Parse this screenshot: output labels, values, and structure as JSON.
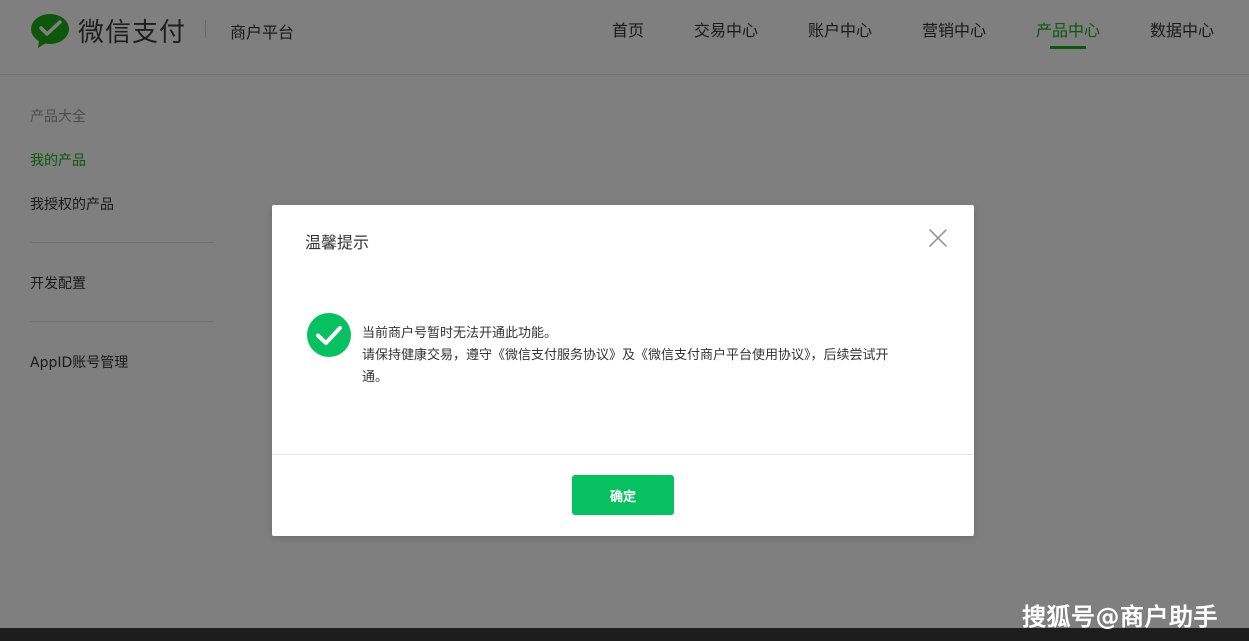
{
  "header": {
    "logo_text": "微信支付",
    "platform_name": "商户平台",
    "nav": [
      {
        "label": "首页"
      },
      {
        "label": "交易中心"
      },
      {
        "label": "账户中心"
      },
      {
        "label": "营销中心"
      },
      {
        "label": "产品中心",
        "active": true
      },
      {
        "label": "数据中心"
      }
    ]
  },
  "sidebar": {
    "items": [
      {
        "label": "产品大全"
      },
      {
        "label": "我的产品",
        "active": true
      },
      {
        "label": "我授权的产品"
      },
      {
        "label": "开发配置"
      },
      {
        "label": "AppID账号管理"
      }
    ]
  },
  "dialog": {
    "title": "温馨提示",
    "message_line1": "当前商户号暂时无法开通此功能。",
    "message_line2": "请保持健康交易，遵守《微信支付服务协议》及《微信支付商户平台使用协议》，后续尝试开",
    "message_line3": "通。",
    "confirm_label": "确定"
  },
  "watermark": "搜狐号@商户助手",
  "colors": {
    "brand_green": "#1aad19",
    "button_green": "#07c160",
    "overlay": "rgba(0,0,0,0.5)"
  },
  "icons": {
    "logo": "wechat-pay-logo-icon",
    "close": "close-icon",
    "success": "success-check-icon"
  }
}
